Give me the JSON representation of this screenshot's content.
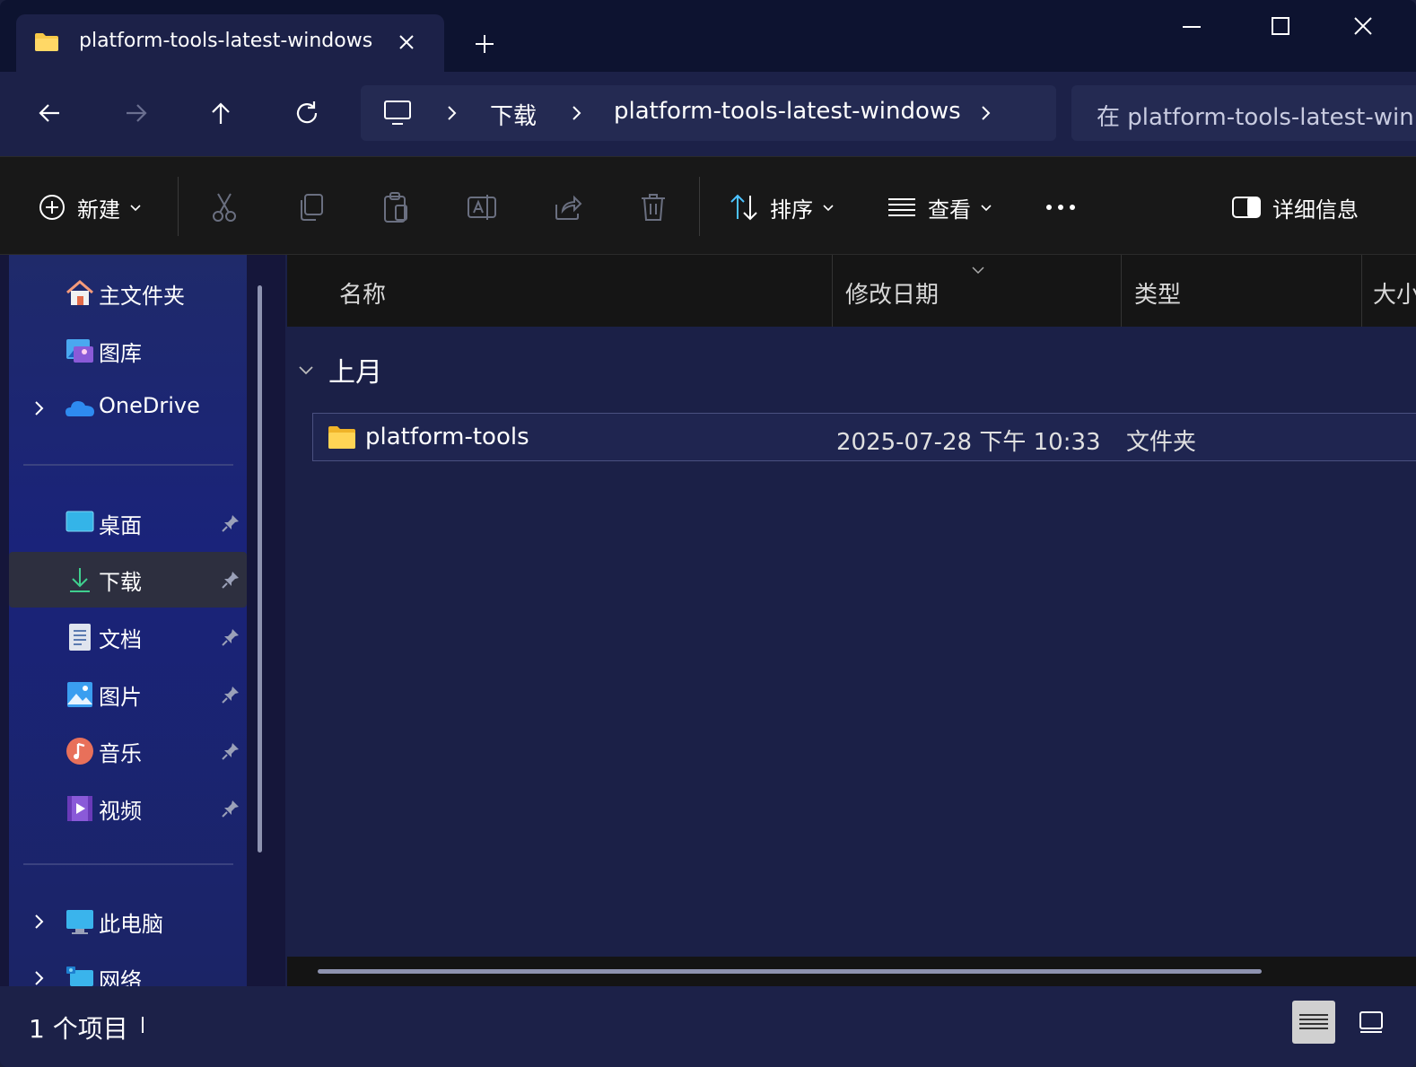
{
  "tab": {
    "title": "platform-tools-latest-windows"
  },
  "address": {
    "crumbs": [
      "下载",
      "platform-tools-latest-windows"
    ]
  },
  "search": {
    "placeholder": "在 platform-tools-latest-win"
  },
  "toolbar": {
    "new_label": "新建",
    "sort_label": "排序",
    "view_label": "查看",
    "details_label": "详细信息"
  },
  "sidebar": {
    "items": [
      {
        "label": "主文件夹",
        "icon": "home-icon"
      },
      {
        "label": "图库",
        "icon": "gallery-icon"
      },
      {
        "label": "OneDrive",
        "icon": "onedrive-icon"
      },
      {
        "label": "桌面",
        "icon": "desktop-icon"
      },
      {
        "label": "下载",
        "icon": "download-icon"
      },
      {
        "label": "文档",
        "icon": "documents-icon"
      },
      {
        "label": "图片",
        "icon": "pictures-icon"
      },
      {
        "label": "音乐",
        "icon": "music-icon"
      },
      {
        "label": "视频",
        "icon": "videos-icon"
      },
      {
        "label": "此电脑",
        "icon": "this-pc-icon"
      },
      {
        "label": "网络",
        "icon": "network-icon"
      }
    ]
  },
  "columns": [
    "名称",
    "修改日期",
    "类型",
    "大小"
  ],
  "group": {
    "label": "上月"
  },
  "files": [
    {
      "name": "platform-tools",
      "date": "2025-07-28 下午 10:33",
      "type": "文件夹"
    }
  ],
  "status": {
    "count": "1 个项目"
  },
  "colors": {
    "accent": "#4cc2ff",
    "folder": "#f7c948",
    "background": "#1b2047"
  }
}
